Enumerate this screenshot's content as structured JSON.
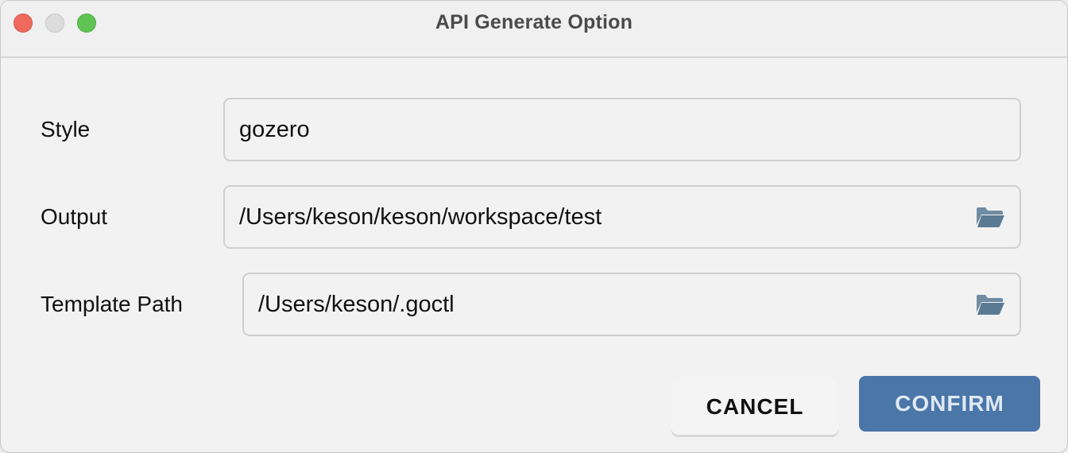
{
  "window": {
    "title": "API Generate Option"
  },
  "form": {
    "style": {
      "label": "Style",
      "value": "gozero"
    },
    "output": {
      "label": "Output",
      "value": "/Users/keson/keson/workspace/test",
      "icon": "folder-icon"
    },
    "template_path": {
      "label": "Template Path",
      "value": "/Users/keson/.goctl",
      "icon": "folder-icon"
    }
  },
  "buttons": {
    "cancel_label": "CANCEL",
    "confirm_label": "CONFIRM"
  },
  "colors": {
    "accent": "#4a76a8",
    "close": "#ee6a5f",
    "zoom": "#5fc454",
    "icon": "#5f7d96"
  }
}
